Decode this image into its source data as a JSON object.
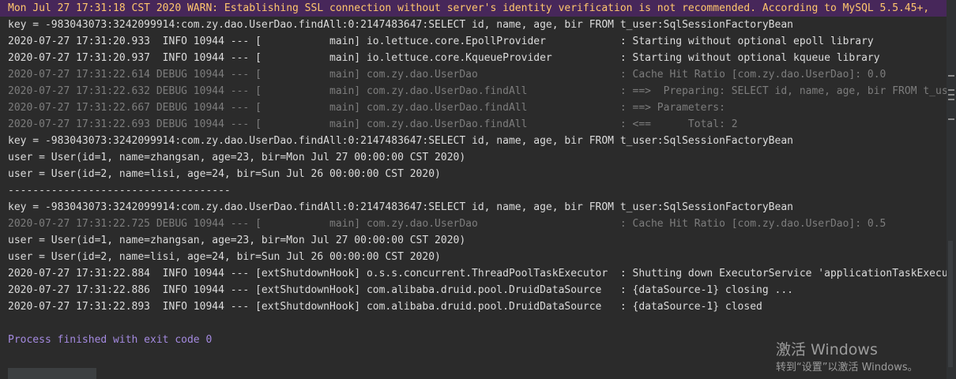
{
  "console": {
    "warn_line": "Mon Jul 27 17:31:18 CST 2020 WARN: Establishing SSL connection without server's identity verification is not recommended. According to MySQL 5.5.45+,",
    "lines": [
      {
        "kind": "info",
        "text": "key = -983043073:3242099914:com.zy.dao.UserDao.findAll:0:2147483647:SELECT id, name, age, bir FROM t_user:SqlSessionFactoryBean"
      },
      {
        "kind": "info",
        "text": "2020-07-27 17:31:20.933  INFO 10944 --- [           main] io.lettuce.core.EpollProvider            : Starting without optional epoll library"
      },
      {
        "kind": "info",
        "text": "2020-07-27 17:31:20.937  INFO 10944 --- [           main] io.lettuce.core.KqueueProvider           : Starting without optional kqueue library"
      },
      {
        "kind": "debug",
        "text": "2020-07-27 17:31:22.614 DEBUG 10944 --- [           main] com.zy.dao.UserDao                       : Cache Hit Ratio [com.zy.dao.UserDao]: 0.0"
      },
      {
        "kind": "debug",
        "text": "2020-07-27 17:31:22.632 DEBUG 10944 --- [           main] com.zy.dao.UserDao.findAll               : ==>  Preparing: SELECT id, name, age, bir FROM t_user"
      },
      {
        "kind": "debug",
        "text": "2020-07-27 17:31:22.667 DEBUG 10944 --- [           main] com.zy.dao.UserDao.findAll               : ==> Parameters: "
      },
      {
        "kind": "debug",
        "text": "2020-07-27 17:31:22.693 DEBUG 10944 --- [           main] com.zy.dao.UserDao.findAll               : <==      Total: 2"
      },
      {
        "kind": "info",
        "text": "key = -983043073:3242099914:com.zy.dao.UserDao.findAll:0:2147483647:SELECT id, name, age, bir FROM t_user:SqlSessionFactoryBean"
      },
      {
        "kind": "info",
        "text": "user = User(id=1, name=zhangsan, age=23, bir=Mon Jul 27 00:00:00 CST 2020)"
      },
      {
        "kind": "info",
        "text": "user = User(id=2, name=lisi, age=24, bir=Sun Jul 26 00:00:00 CST 2020)"
      },
      {
        "kind": "sep",
        "text": "------------------------------------"
      },
      {
        "kind": "info",
        "text": "key = -983043073:3242099914:com.zy.dao.UserDao.findAll:0:2147483647:SELECT id, name, age, bir FROM t_user:SqlSessionFactoryBean"
      },
      {
        "kind": "debug",
        "text": "2020-07-27 17:31:22.725 DEBUG 10944 --- [           main] com.zy.dao.UserDao                       : Cache Hit Ratio [com.zy.dao.UserDao]: 0.5"
      },
      {
        "kind": "info",
        "text": "user = User(id=1, name=zhangsan, age=23, bir=Mon Jul 27 00:00:00 CST 2020)"
      },
      {
        "kind": "info",
        "text": "user = User(id=2, name=lisi, age=24, bir=Sun Jul 26 00:00:00 CST 2020)"
      },
      {
        "kind": "info",
        "text": "2020-07-27 17:31:22.884  INFO 10944 --- [extShutdownHook] o.s.s.concurrent.ThreadPoolTaskExecutor  : Shutting down ExecutorService 'applicationTaskExecutor'"
      },
      {
        "kind": "info",
        "text": "2020-07-27 17:31:22.886  INFO 10944 --- [extShutdownHook] com.alibaba.druid.pool.DruidDataSource   : {dataSource-1} closing ..."
      },
      {
        "kind": "info",
        "text": "2020-07-27 17:31:22.893  INFO 10944 --- [extShutdownHook] com.alibaba.druid.pool.DruidDataSource   : {dataSource-1} closed"
      }
    ],
    "exit_line": "Process finished with exit code 0"
  },
  "watermark": {
    "line1": "激活 Windows",
    "line2": "转到“设置”以激活 Windows。"
  },
  "colors": {
    "background": "#2b2b2b",
    "warn_bar": "#47275a",
    "warn_text": "#ffc66d",
    "info_text": "#dcdcdc",
    "debug_text": "#7d7d7d",
    "exit_text": "#a48ae0"
  }
}
